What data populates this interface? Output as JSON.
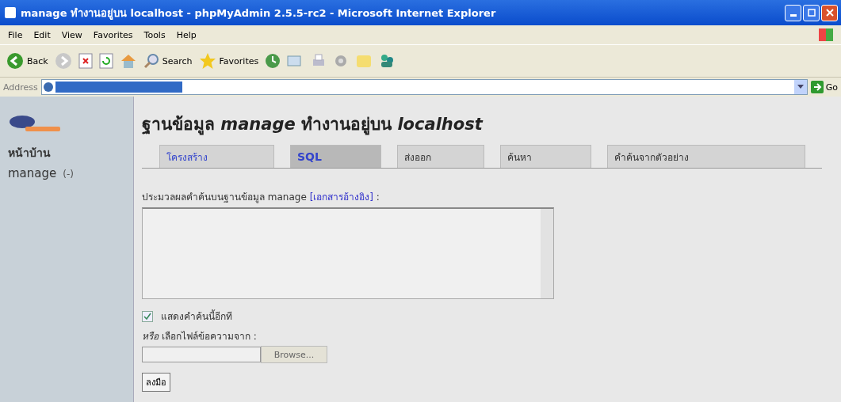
{
  "window": {
    "title": "manage ทำงานอยู่บน localhost - phpMyAdmin 2.5.5-rc2 - Microsoft Internet Explorer"
  },
  "menu": [
    "File",
    "Edit",
    "View",
    "Favorites",
    "Tools",
    "Help"
  ],
  "toolbar": {
    "back": "Back",
    "search": "Search",
    "favorites": "Favorites"
  },
  "address_bar": {
    "label": "Address",
    "go": "Go"
  },
  "sidebar": {
    "items": [
      {
        "label": "หน้าบ้าน",
        "kind": "link"
      },
      {
        "label": "manage",
        "count": "(-)",
        "kind": "db"
      }
    ]
  },
  "heading": {
    "prefix": "ฐานข้อมูล",
    "db": "manage",
    "middle": "ทำงานอยู่บน",
    "host": "localhost"
  },
  "tabs": [
    {
      "label": "โครงสร้าง",
      "selected": false
    },
    {
      "label": "SQL",
      "selected": true
    },
    {
      "label": "ส่งออก",
      "selected": false
    },
    {
      "label": "ค้นหา",
      "selected": false
    },
    {
      "label": "คำค้นจากตัวอย่าง",
      "selected": false
    }
  ],
  "sql_form": {
    "label": "ประมวลผลคำค้นบนฐานข้อมูล manage",
    "doc_link": "[เอกสารอ้างอิง]",
    "colon": ":",
    "show_query": {
      "label": "แสดงคำค้นนี้อีกที",
      "checked": true
    },
    "file_label": "*หรือ* เลือกไฟล์ข้อความจาก :",
    "browse": "Browse...",
    "submit": "ลงมือ"
  }
}
